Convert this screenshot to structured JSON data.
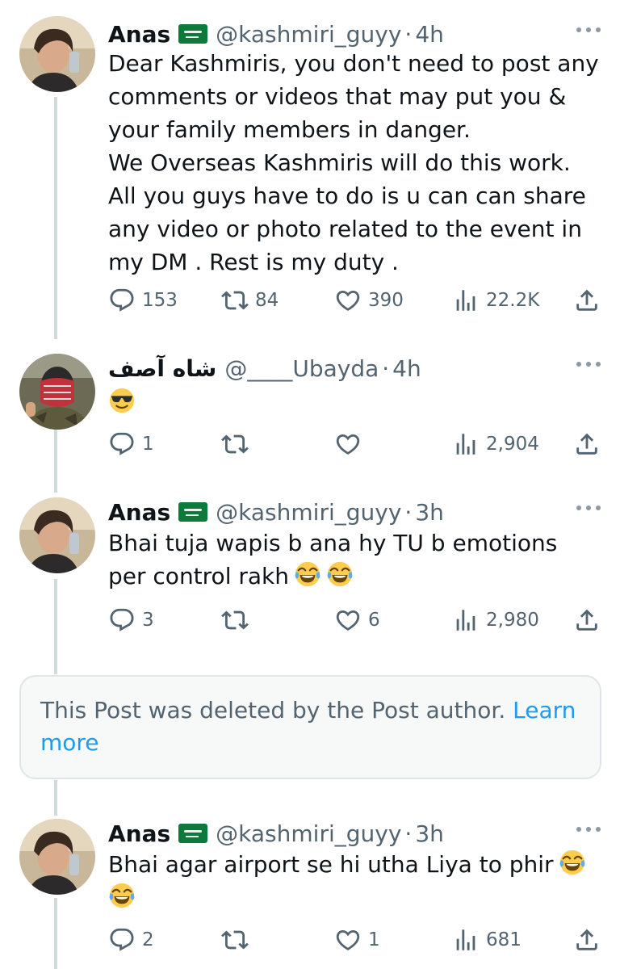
{
  "posts": [
    {
      "name": "Anas",
      "flag": "saudi-flag-emoji",
      "handle": "@kashmiri_guyy",
      "time": "4h",
      "text_lines": [
        "Dear Kashmiris, you don't need to post any",
        "comments or videos that may put you &",
        "your family members in danger.",
        "We Overseas Kashmiris will do this work.",
        "All you guys have to do is u can can share",
        "any video or photo related to the event in",
        "my DM . Rest is my duty ."
      ],
      "replies": "153",
      "reposts": "84",
      "likes": "390",
      "views": "22.2K"
    },
    {
      "name": "شاه آصف",
      "handle": "@____Ubayda",
      "time": "4h",
      "emoji": "sunglasses-smiley-emoji",
      "replies": "1",
      "reposts": "",
      "likes": "",
      "views": "2,904"
    },
    {
      "name": "Anas",
      "flag": "saudi-flag-emoji",
      "handle": "@kashmiri_guyy",
      "time": "3h",
      "text_lines": [
        "Bhai tuja wapis b ana hy TU b emotions",
        "per control rakh"
      ],
      "emoji": "tears-of-joy-emoji",
      "replies": "3",
      "reposts": "",
      "likes": "6",
      "views": "2,980"
    },
    {
      "name": "Anas",
      "flag": "saudi-flag-emoji",
      "handle": "@kashmiri_guyy",
      "time": "3h",
      "text_lines": [
        "Bhai agar airport se hi utha Liya to phir"
      ],
      "emoji": "tears-of-joy-emoji",
      "replies": "2",
      "reposts": "",
      "likes": "1",
      "views": "681"
    }
  ],
  "deleted_notice": {
    "text": "This Post was deleted by the Post author.",
    "link": "Learn more"
  },
  "separator": "·",
  "colors": {
    "link": "#1d9bf0",
    "secondary_text": "#536471",
    "thread_line": "#cfd9de",
    "notice_bg": "#f7f9f9"
  }
}
